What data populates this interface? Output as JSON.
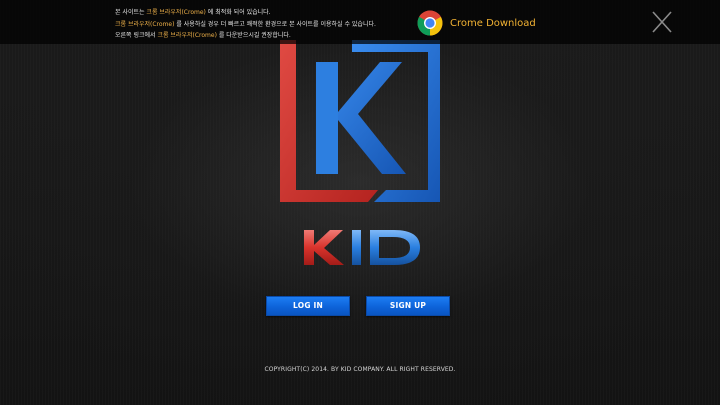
{
  "notice": {
    "lines": [
      {
        "before": "본 사이트는 ",
        "highlight": "크롬 브라우저(Crome)",
        "after": " 에 최적화 되어 있습니다."
      },
      {
        "before": "",
        "highlight": "크롬 브라우저(Crome)",
        "after": " 를 사용하실 경우 더 빠르고 쾌적한 환경으로 본 사이트를 이용하실 수 있습니다."
      },
      {
        "before": "오른쪽 링크에서 ",
        "highlight": "크롬 브라우저(Crome)",
        "after": " 를 다운받으시길 권장합니다."
      }
    ],
    "download_label": "Crome Download",
    "download_icon": "chrome-logo-icon",
    "close_icon": "close-icon"
  },
  "logo": {
    "icon": "kid-logo-icon",
    "wordmark": "KID"
  },
  "actions": {
    "login_label": "LOG IN",
    "signup_label": "SIGN UP"
  },
  "footer": {
    "copyright": "COPYRIGHT(C) 2014. BY KID COMPANY. ALL RIGHT RESERVED."
  },
  "colors": {
    "background": "#141414",
    "notice_highlight": "#f0b24a",
    "logo_red": "#d63a34",
    "logo_blue": "#1f74d6",
    "button_blue": "#0d63d9"
  }
}
